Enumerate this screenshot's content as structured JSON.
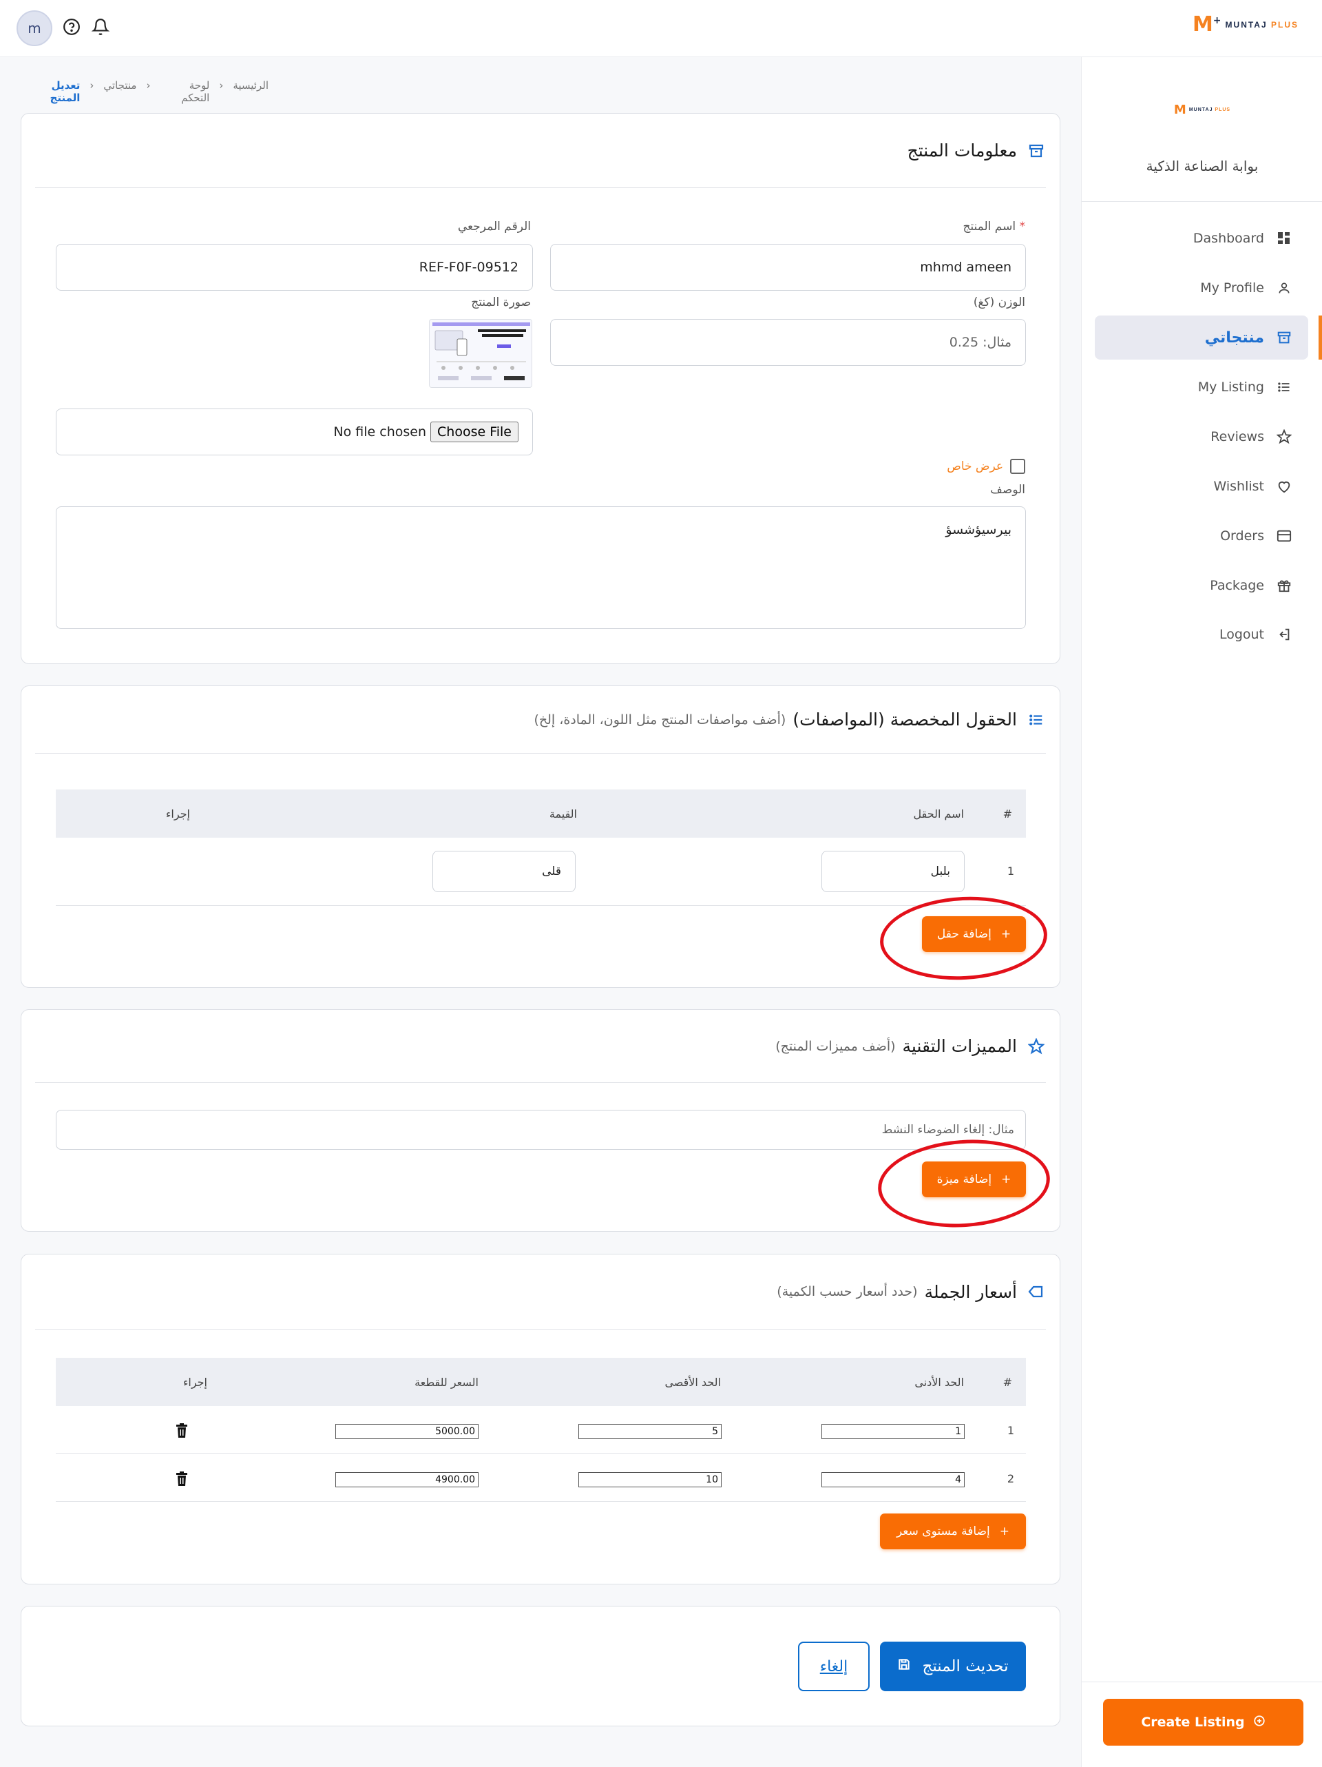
{
  "header": {
    "avatar_initial": "m",
    "brand": "MUNTAJ",
    "brand_suffix": "PLUS"
  },
  "sidebar": {
    "portal_name": "بوابة الصناعة الذكية",
    "items": [
      {
        "label": "Dashboard",
        "icon": "grid-icon"
      },
      {
        "label": "My Profile",
        "icon": "user-icon"
      },
      {
        "label": "منتجاتي",
        "icon": "archive-icon",
        "active": true
      },
      {
        "label": "My Listing",
        "icon": "list-icon"
      },
      {
        "label": "Reviews",
        "icon": "star-icon"
      },
      {
        "label": "Wishlist",
        "icon": "heart-icon"
      },
      {
        "label": "Orders",
        "icon": "card-icon"
      },
      {
        "label": "Package",
        "icon": "gift-icon"
      },
      {
        "label": "Logout",
        "icon": "logout-icon"
      }
    ],
    "create_listing": "Create Listing"
  },
  "breadcrumb": [
    "الرئيسية",
    "لوحة التحكم",
    "منتجاتي",
    "تعديل المنتج"
  ],
  "product_info": {
    "title": "معلومات المنتج",
    "name_label": "اسم المنتج",
    "name_value": "mhmd ameen",
    "ref_label": "الرقم المرجعي",
    "ref_value": "REF-F0F-09512",
    "weight_label": "الوزن (كغ)",
    "weight_placeholder": "مثال: 0.25",
    "image_label": "صورة المنتج",
    "file_status": "No file chosen",
    "choose_file": "Choose File",
    "special_offer": "عرض خاص",
    "description_label": "الوصف",
    "description_value": "بيرسيؤشسؤ"
  },
  "custom_fields": {
    "title": "الحقول المخصصة (المواصفات)",
    "subtitle": "(أضف مواصفات المنتج مثل اللون، المادة، إلخ)",
    "columns": [
      "#",
      "اسم الحقل",
      "القيمة",
      "إجراء"
    ],
    "rows": [
      {
        "num": "1",
        "name": "بلبل",
        "value": "قلى"
      }
    ],
    "add_button": "إضافة حقل"
  },
  "features": {
    "title": "المميزات التقنية",
    "subtitle": "(أضف مميزات المنتج)",
    "placeholder": "مثال: إلغاء الضوضاء النشط",
    "add_button": "إضافة ميزة"
  },
  "wholesale": {
    "title": "أسعار الجملة",
    "subtitle": "(حدد أسعار حسب الكمية)",
    "columns": [
      "#",
      "الحد الأدنى",
      "الحد الأقصى",
      "السعر للقطعة",
      "إجراء"
    ],
    "rows": [
      {
        "num": "1",
        "min": "1",
        "max": "5",
        "price": "5000.00"
      },
      {
        "num": "2",
        "min": "4",
        "max": "10",
        "price": "4900.00"
      }
    ],
    "add_button": "إضافة مستوى سعر"
  },
  "actions": {
    "update": "تحديث المنتج",
    "cancel": "إلغاء"
  },
  "colors": {
    "primary": "#0b6ccc",
    "accent": "#f96d05",
    "annotation": "#e3101a"
  }
}
